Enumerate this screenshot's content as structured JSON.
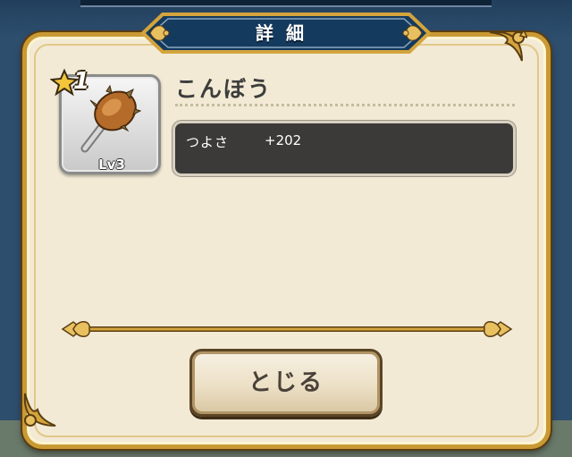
{
  "dialog": {
    "title": "詳細"
  },
  "item": {
    "rarity": "1",
    "level": "Lv3",
    "name": "こんぼう",
    "icon": "club-icon"
  },
  "stats": [
    {
      "label": "つよさ",
      "value": "+202"
    }
  ],
  "buttons": {
    "close_label": "とじる"
  },
  "colors": {
    "frame_gold": "#c99a34",
    "panel_bg": "#f2ead5",
    "banner_blue": "#143a5e",
    "stat_box_bg": "#3b3a38"
  }
}
